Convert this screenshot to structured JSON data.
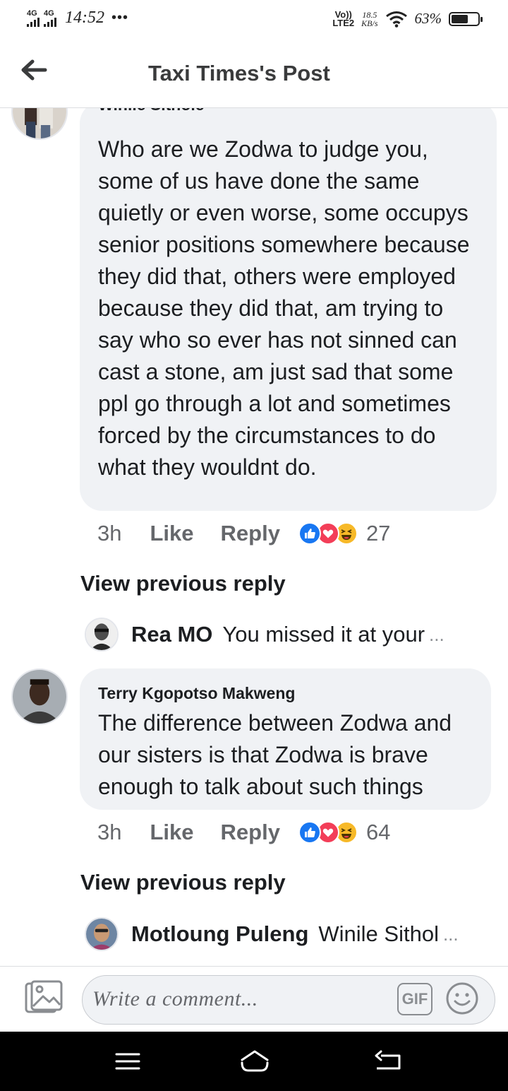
{
  "status_bar": {
    "signal1": "4G",
    "signal2": "4G",
    "time": "14:52",
    "dots": "•••",
    "volte_top": "Vo))",
    "volte_bottom": "LTE2",
    "speed_top": "18.5",
    "speed_bottom": "KB/s",
    "battery": "63%",
    "battery_level": 0.63
  },
  "header": {
    "title": "Taxi Times's Post"
  },
  "comments": [
    {
      "author": "Winile Sithole",
      "text": "Who are we Zodwa to judge you, some of us have done the  same quietly or even worse, some occupys senior positions somewhere because they did that, others were employed because they did that, am trying to say who so ever has not sinned can cast a stone, am just sad that some ppl go through a lot and sometimes forced by the circumstances to do what they wouldnt do.",
      "time": "3h",
      "like_label": "Like",
      "reply_label": "Reply",
      "reaction_count": "27",
      "view_previous": "View previous reply",
      "reply_preview": {
        "name": "Rea MO",
        "text": "You missed it at your",
        "ellipsis": "..."
      }
    },
    {
      "author": "Terry Kgopotso Makweng",
      "text": "The difference between Zodwa and our sisters is that Zodwa is brave enough to talk about such things",
      "time": "3h",
      "like_label": "Like",
      "reply_label": "Reply",
      "reaction_count": "64",
      "view_previous": "View previous reply",
      "reply_preview": {
        "name": "Motloung Puleng",
        "text": "Winile Sithol",
        "ellipsis": "..."
      }
    }
  ],
  "composer": {
    "placeholder": "Write a comment...",
    "gif_label": "GIF"
  },
  "colors": {
    "bubble": "#f0f2f5",
    "like_blue": "#1877f2",
    "love_red": "#f33e58",
    "haha_yellow": "#f7b928",
    "meta_gray": "#65676b"
  },
  "icons": [
    "back-arrow-icon",
    "wifi-icon",
    "battery-icon",
    "photo-icon",
    "gif-icon",
    "emoji-icon",
    "menu-icon",
    "home-icon",
    "back-nav-icon"
  ]
}
